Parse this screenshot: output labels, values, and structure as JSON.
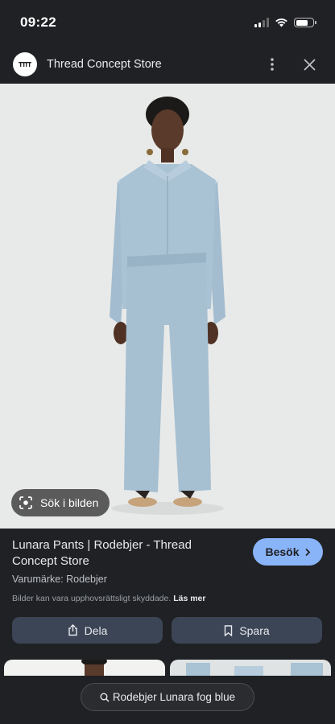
{
  "status_bar": {
    "time": "09:22",
    "battery_level": 0.72
  },
  "header": {
    "site_name": "Thread Concept Store",
    "logo_icon": "thread-logo-icon",
    "more_icon": "more-vert-icon",
    "close_icon": "close-icon"
  },
  "image": {
    "lens_label": "Sök i bilden",
    "lens_icon": "lens-icon"
  },
  "result": {
    "title": "Lunara Pants | Rodebjer - Thread Concept Store",
    "visit_label": "Besök",
    "brand_label": "Varumärke: ",
    "brand_value": "Rodebjer",
    "copyright_text": "Bilder kan vara upphovsrättsligt skyddade.",
    "read_more": "Läs mer"
  },
  "actions": {
    "share_label": "Dela",
    "save_label": "Spara"
  },
  "search": {
    "query": "Rodebjer Lunara fog blue",
    "icon": "search-icon"
  },
  "colors": {
    "accent": "#8ab4f8",
    "background": "#202124",
    "action_button": "#3c4556",
    "outfit": "#a9c2d4"
  }
}
